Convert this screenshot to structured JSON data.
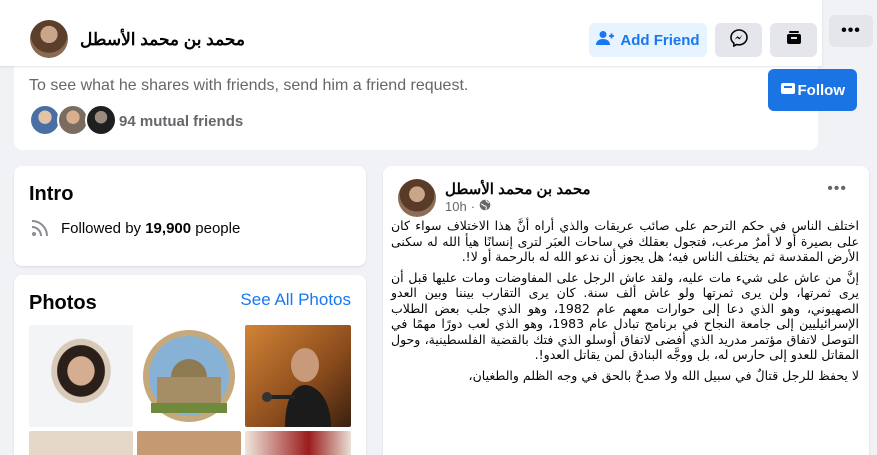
{
  "header": {
    "profile_name": "محمد بن محمد الأسطل",
    "add_friend_label": "Add Friend",
    "follow_label": "Follow",
    "follow_visible": "Fo",
    "icons": [
      "user-plus-icon",
      "messenger-icon",
      "more-actions-icon",
      "ellipsis-icon"
    ]
  },
  "top_card": {
    "subtitle": "To see what he shares with friends, send him a friend request.",
    "mutual_friends": "94 mutual friends"
  },
  "intro": {
    "title": "Intro",
    "followed_prefix": "Followed by ",
    "followed_count": "19,900",
    "followed_suffix": " people"
  },
  "photos": {
    "title": "Photos",
    "see_all": "See All Photos"
  },
  "post": {
    "author": "محمد بن محمد الأسطل",
    "time": "10h",
    "paragraphs": [
      "اختلف الناس في حكم الترحم على صائب عريقات والذي أراه أنَّ هذا الاختلاف سواء كان على بصيرة أو لا أمرٌ مرعب، فتجول بعقلك في ساحات العبَر لترى إنسانًا هيأ الله له سكنى الأرض المقدسة ثم يختلف الناس فيه؛ هل يجوز أن ندعو الله له بالرحمة أو لا!.",
      "إنَّ من عاش على شيء مات عليه، ولقد عاش الرجل على المفاوضات ومات عليها قبل أن يرى ثمرتها، ولن يرى ثمرتها ولو عاش ألف سنة. كان يرى التقارب بيننا وبين العدو الصهيوني، وهو الذي دعا إلى حوارات معهم عام 1982، وهو الذي جلب بعض الطلاب الإسرائيليين إلى جامعة النجاح في برنامج تبادل عام 1983، وهو الذي لعب دورًا مهمًا في التوصل لاتفاق مؤتمر مدريد الذي أفضى لاتفاق أوسلو الذي فتك بالقضية الفلسطينية، وحول المقاتل للعدو إلى حارس له، بل ووجَّه البنادق لمن يقاتل العدو!.",
      "لا يحفظ للرجل قتالٌ في سبيل الله ولا صدحٌ بالحق في وجه الظلم والطغيان،"
    ]
  },
  "colors": {
    "brand_blue": "#1877f2",
    "follow_bg": "#1b74e4",
    "add_friend_bg": "#e7f3ff",
    "page_bg": "#f0f2f5"
  }
}
